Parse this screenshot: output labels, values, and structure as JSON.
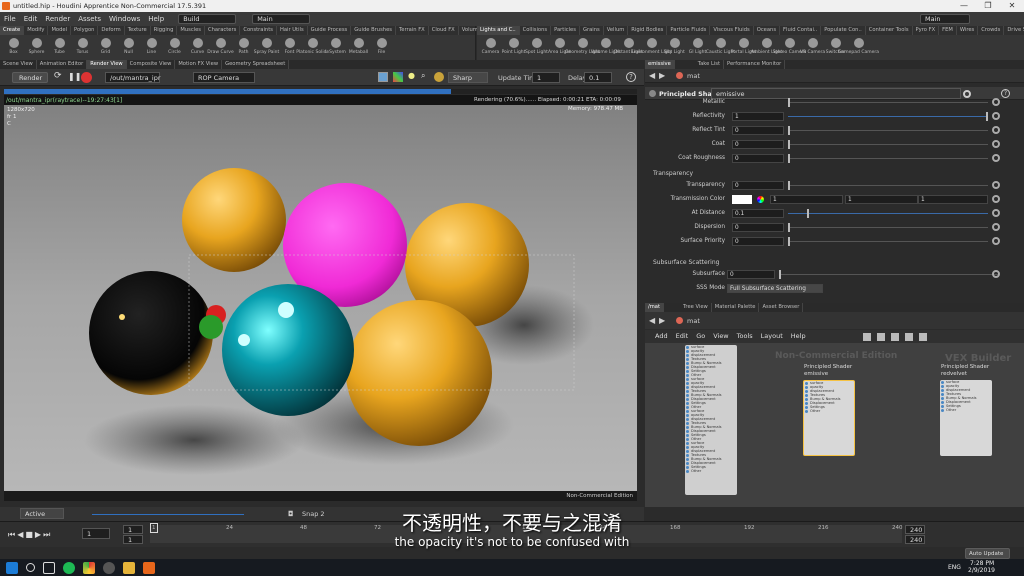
{
  "window": {
    "title": "untitled.hip - Houdini Apprentice Non-Commercial 17.5.391",
    "min": "—",
    "max": "❐",
    "close": "✕"
  },
  "menu": {
    "items": [
      "File",
      "Edit",
      "Render",
      "Assets",
      "Windows",
      "Help"
    ],
    "desktop": "Build",
    "desktop2": "Main",
    "desktop_right": "Main"
  },
  "shelf_left": {
    "tabs": [
      "Create",
      "Modify",
      "Model",
      "Polygon",
      "Deform",
      "Texture",
      "Rigging",
      "Muscles",
      "Characters",
      "Constraints",
      "Hair Utils",
      "Guide Process",
      "Guide Brushes",
      "Terrain FX",
      "Cloud FX",
      "Volume"
    ],
    "tools": [
      "Box",
      "Sphere",
      "Tube",
      "Torus",
      "Grid",
      "Null",
      "Line",
      "Circle",
      "Curve",
      "Draw Curve",
      "Path",
      "Spray Paint",
      "Font",
      "Platonic Solids",
      "L-System",
      "Metaball",
      "File"
    ]
  },
  "shelf_right": {
    "tabs": [
      "Lights and C..",
      "Collisions",
      "Particles",
      "Grains",
      "Vellum",
      "Rigid Bodies",
      "Particle Fluids",
      "Viscous Fluids",
      "Oceans",
      "Fluid Contai..",
      "Populate Con..",
      "Container Tools",
      "Pyro FX",
      "FEM",
      "Wires",
      "Crowds",
      "Drive Simula.."
    ],
    "tools": [
      "Camera",
      "Point Light",
      "Spot Light",
      "Area Light",
      "Geometry Light",
      "Volume Light",
      "Distant Light",
      "Environment Light",
      "Sky Light",
      "GI Light",
      "Caustic Light",
      "Portal Light",
      "Ambient Light",
      "Stereo Camera",
      "VR Camera",
      "Switcher",
      "Gamepad Camera"
    ]
  },
  "viewport_tabs": [
    "Scene View",
    "Animation Editor",
    "Render View",
    "Composite View",
    "Motion FX View",
    "Geometry Spreadsheet"
  ],
  "render_bar": {
    "render_btn": "Render",
    "output": "/out/mantra_ipr",
    "camera": "ROP Camera",
    "sharp": "Sharp",
    "update_label": "Update Time",
    "update_val": "1",
    "delay_label": "Delay",
    "delay_val": "0.1"
  },
  "viewport": {
    "path": "/out/mantra_ipr(raytrace)--19:27:43[1]",
    "res": "1280x720",
    "frame": "fr 1",
    "chan": "C",
    "status": "Rendering (70.6%)...... Elapsed: 0:00:21  ETA: 0:00:09",
    "memory": "Memory:    978.47 MB",
    "footer": "Non-Commercial Edition"
  },
  "bottom_bar": {
    "active_render": "Active Render",
    "snap": "Snap 2"
  },
  "param_tabs": [
    "emissive",
    "Take List",
    "Performance Monitor"
  ],
  "param_path": "mat",
  "shader": {
    "type": "Principled Shader",
    "name": "emissive"
  },
  "params": [
    {
      "label": "Metallic",
      "value": "",
      "knob": 0
    },
    {
      "label": "Reflectivity",
      "value": "1",
      "knob": 1
    },
    {
      "label": "Reflect Tint",
      "value": "0",
      "knob": 0
    },
    {
      "label": "Coat",
      "value": "0",
      "knob": 0
    },
    {
      "label": "Coat Roughness",
      "value": "0",
      "knob": 0
    }
  ],
  "transparency": {
    "section": "Transparency",
    "transparency": "0",
    "trans_color_1": "1",
    "trans_color_2": "1",
    "trans_color_3": "1",
    "at_distance": "0.1",
    "dispersion": "0",
    "surface_priority": "0",
    "labels": {
      "transparency": "Transparency",
      "trans_color": "Transmission Color",
      "at_distance": "At Distance",
      "dispersion": "Dispersion",
      "surface_priority": "Surface Priority"
    }
  },
  "sss": {
    "section": "Subsurface Scattering",
    "subsurface_label": "Subsurface",
    "subsurface": "0",
    "mode_label": "SSS Mode",
    "mode": "Full Subsurface Scattering"
  },
  "network_tabs": [
    "/mat",
    "Tree View",
    "Material Palette",
    "Asset Browser"
  ],
  "network_path": "mat",
  "network_menu": [
    "Add",
    "Edit",
    "Go",
    "View",
    "Tools",
    "Layout",
    "Help"
  ],
  "network": {
    "watermark": "Non-Commercial Edition",
    "watermark2": "VEX Builder",
    "node1_type": "Principled Shader",
    "node1_name": "emissive",
    "node2_type": "Principled Shader",
    "node2_name": "redvelvet",
    "pins": [
      "surface",
      "opacity",
      "displacement",
      "Textures",
      "Bump & Normals",
      "Displacement",
      "Settings",
      "Other"
    ]
  },
  "timeline": {
    "frame": "1",
    "start": "1",
    "ticks": [
      "1",
      "24",
      "48",
      "72",
      "96",
      "120",
      "144",
      "168",
      "192",
      "216",
      "240"
    ],
    "end": "240",
    "end2": "240",
    "auto_update": "Auto Update"
  },
  "taskbar": {
    "lang": "ENG",
    "time": "7:28 PM",
    "date": "2/9/2019"
  },
  "subtitles": {
    "cn": "不透明性，不要与之混淆",
    "en": "the opacity it's not to be confused with"
  }
}
